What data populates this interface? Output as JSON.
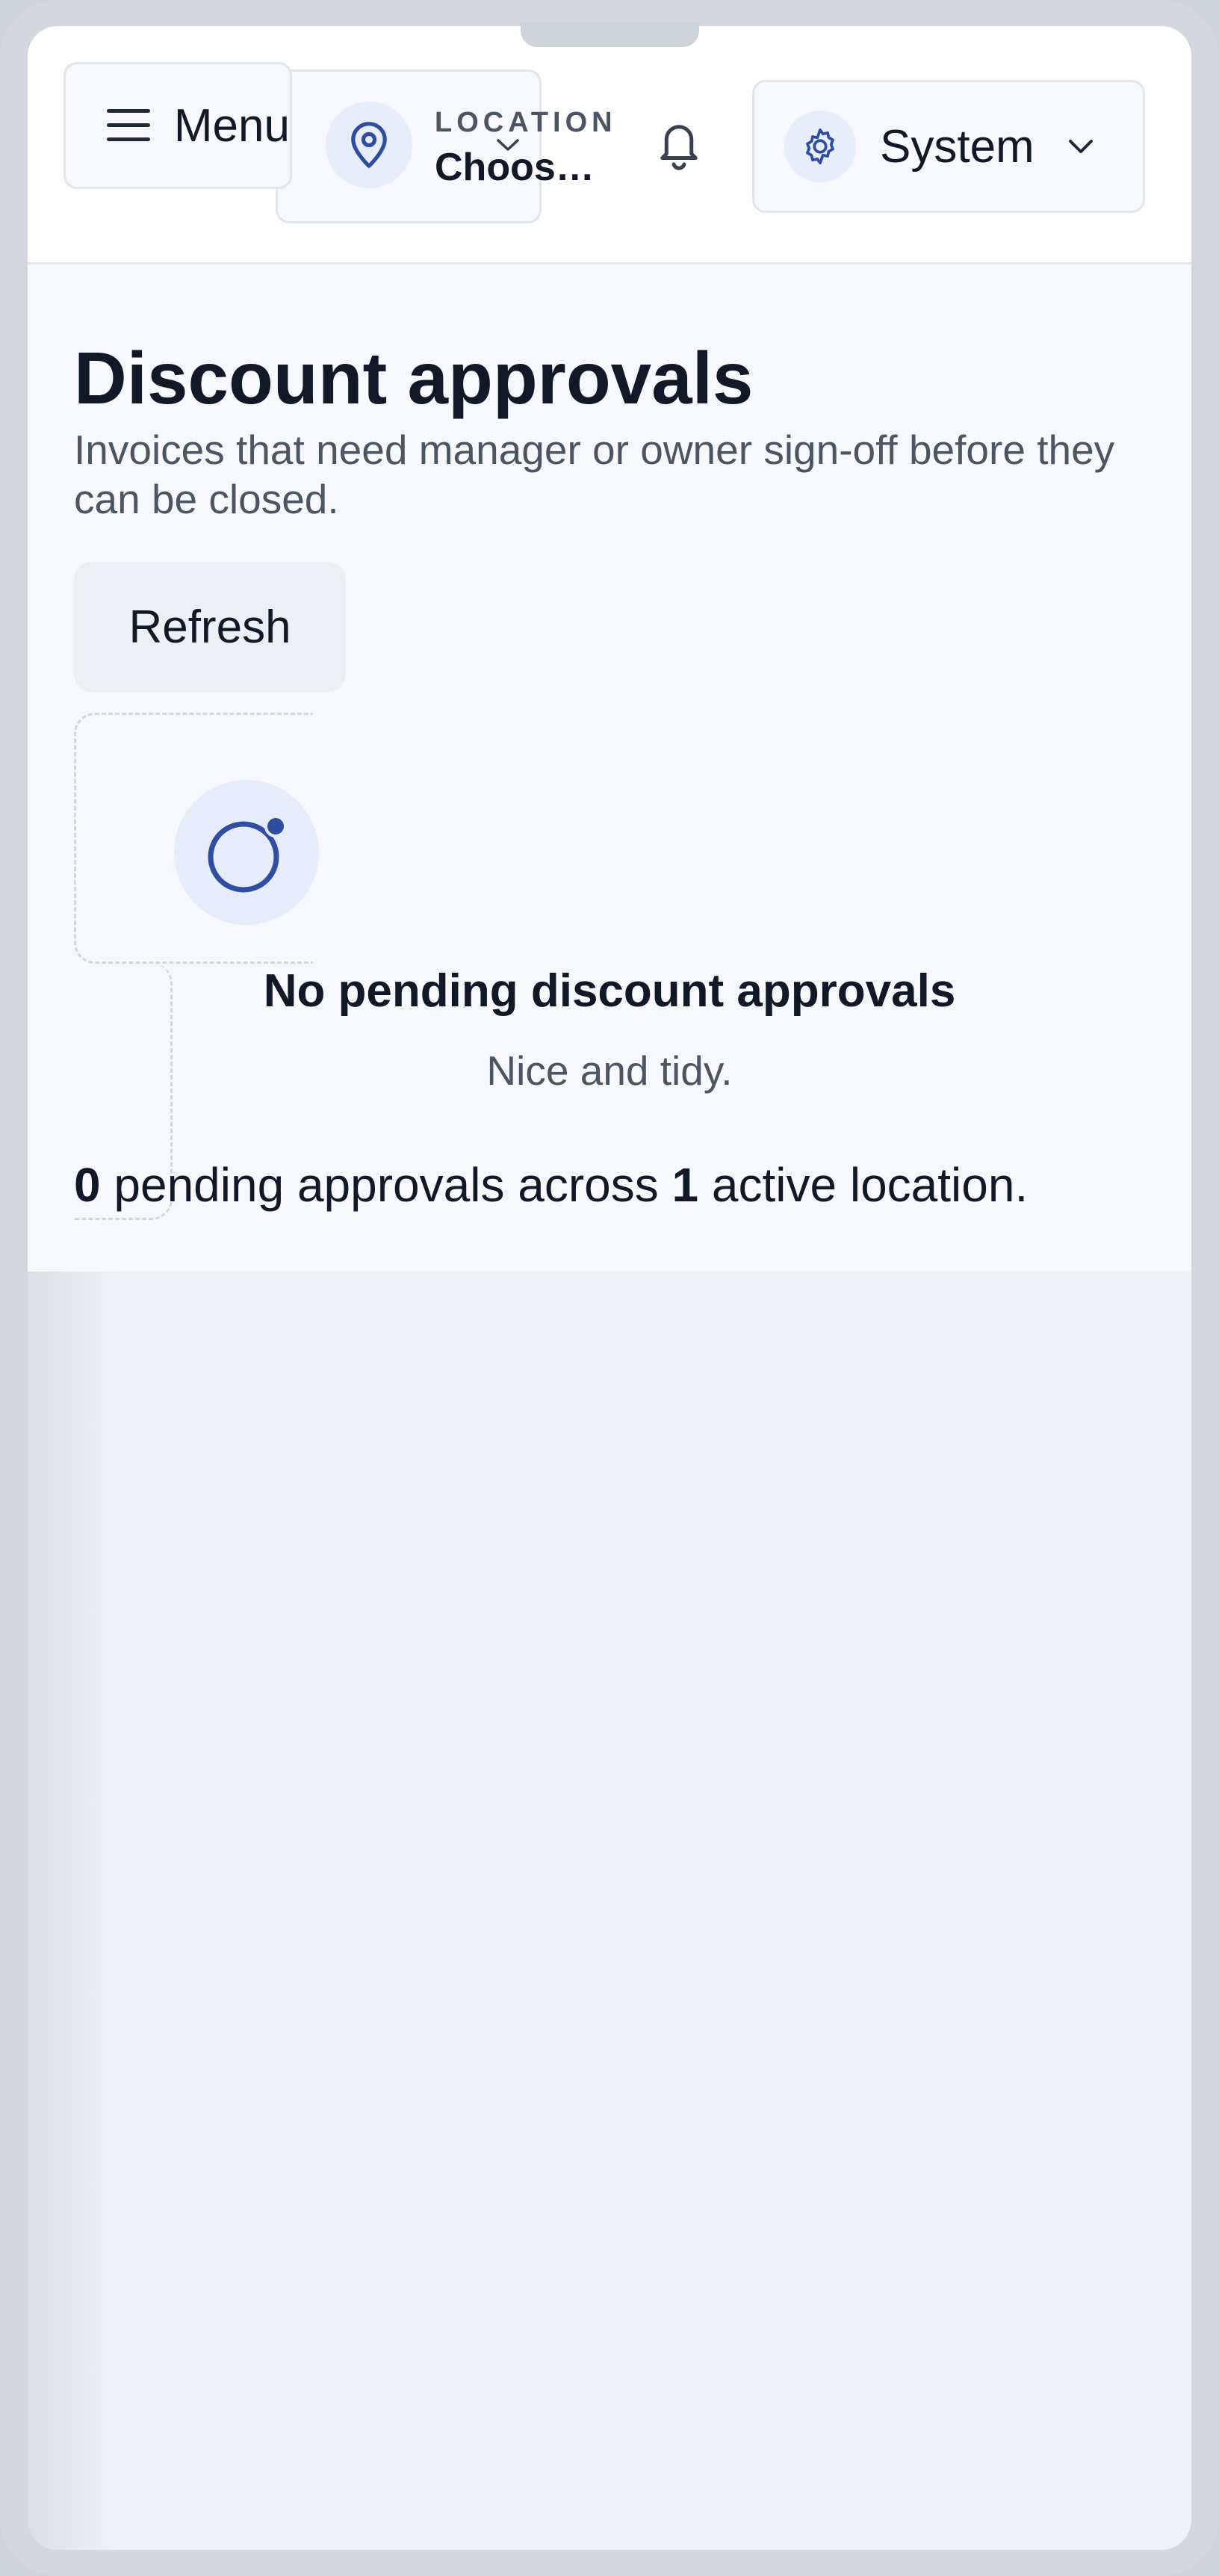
{
  "header": {
    "menu_label": "Menu",
    "location_caption": "LOCATION",
    "location_value": "Choos…",
    "system_label": "System"
  },
  "page": {
    "title": "Discount approvals",
    "description": "Invoices that need manager or owner sign-off before they can be closed.",
    "refresh_label": "Refresh"
  },
  "empty_state": {
    "title": "No pending discount approvals",
    "subtitle": "Nice and tidy."
  },
  "summary": {
    "pending_count": "0",
    "text_middle": " pending approvals across ",
    "location_count": "1",
    "text_end": " active location."
  },
  "icons": {
    "menu": "hamburger-icon",
    "location": "map-pin-icon",
    "dropdown": "chevron-down-icon",
    "notifications": "bell-icon",
    "system": "gear-icon",
    "empty": "ring-with-dot-icon"
  },
  "colors": {
    "accent": "#2f4ea2",
    "accent_soft": "#e8edfc",
    "text_primary": "#111827",
    "text_secondary": "#4b5563",
    "surface": "#f6f8fc"
  }
}
